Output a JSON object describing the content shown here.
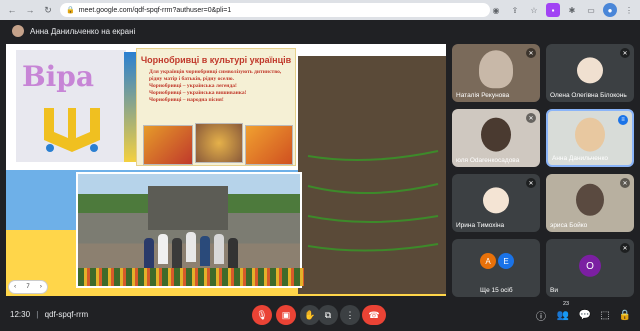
{
  "browser": {
    "url": "meet.google.com/qdf-spqf-rrm?authuser=0&pli=1"
  },
  "presenter_bar": {
    "label": "Анна Данильченко на екрані"
  },
  "slide": {
    "vira_text": "Віра",
    "title": "Чорнобривці в культурі українців",
    "bullets": [
      "Для українців чорнобривці символізують дитинство, рідну матір і батьків, рідну оселю.",
      "Чорнобривці – українська легенда!",
      "Чорнобривці – українська вишиванка!",
      "Чорнобривці – народна пісня!"
    ],
    "controls": {
      "prev": "‹",
      "page": "7",
      "next": "›"
    }
  },
  "participants": [
    {
      "name": "Наталія Рекунова",
      "muted": true
    },
    {
      "name": "Олена Олегівна Білоконь",
      "muted": true,
      "avatar_color": "#ffffff"
    },
    {
      "name": "юля Оdarенкосадова",
      "muted": true
    },
    {
      "name": "Анна Данильченко",
      "muted": false
    },
    {
      "name": "Ирина Тимохіна",
      "muted": true,
      "avatar_color": "#ffffff"
    },
    {
      "name": "эриса Бойко",
      "muted": true
    },
    {
      "name": "Ще 15 осіб",
      "muted": false,
      "avatars": [
        "A",
        "E"
      ]
    },
    {
      "name": "Ви",
      "muted": true,
      "avatar": "O"
    }
  ],
  "controls": {
    "time": "12:30",
    "meeting_code": "qdf-spqf-rrm",
    "participant_count": "23"
  },
  "colors": {
    "end_call": "#ea4335",
    "bar_bg": "#202124",
    "tile_bg": "#3c4043"
  }
}
